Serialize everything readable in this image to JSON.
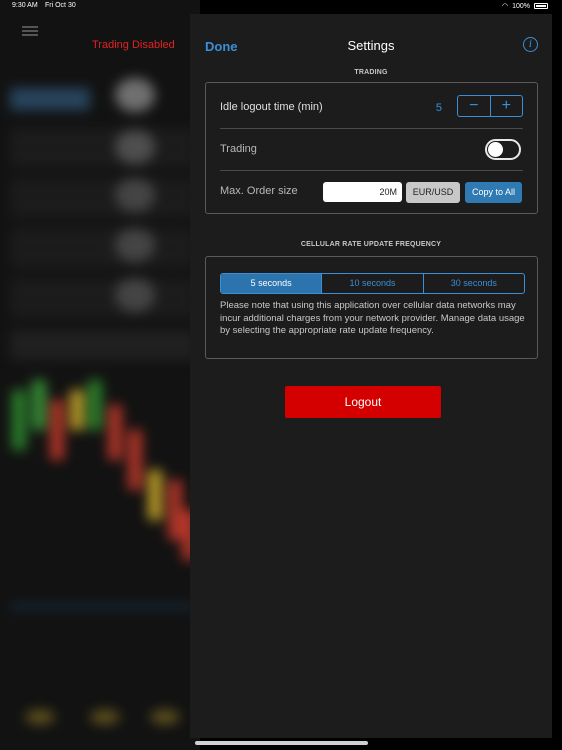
{
  "status_bar": {
    "time": "9:30 AM",
    "date": "Fri Oct 30",
    "battery": "100%",
    "wifi_icon": "wifi-icon"
  },
  "background_app": {
    "status": "Trading Disabled",
    "status_color": "#e02424"
  },
  "nav": {
    "done_label": "Done",
    "title": "Settings",
    "info_icon": "info-icon"
  },
  "trading_section": {
    "title": "TRADING",
    "idle_logout": {
      "label": "Idle logout time (min)",
      "value": "5",
      "decrement": "−",
      "increment": "+"
    },
    "trading_toggle": {
      "label": "Trading",
      "on": false
    },
    "max_order": {
      "label": "Max. Order size",
      "value": "20M",
      "pair": "EUR/USD",
      "copy_label": "Copy to All"
    }
  },
  "cellular_section": {
    "title": "CELLULAR RATE UPDATE FREQUENCY",
    "options": [
      "5 seconds",
      "10 seconds",
      "30 seconds"
    ],
    "selected": "5 seconds",
    "note": "Please note that using this application over cellular data networks may incur additional charges from your network provider. Manage data usage by selecting the appropriate rate update frequency."
  },
  "logout_label": "Logout",
  "colors": {
    "accent": "#3a8fd6",
    "logout": "#d40000",
    "selected_segment": "#2b74ae"
  }
}
